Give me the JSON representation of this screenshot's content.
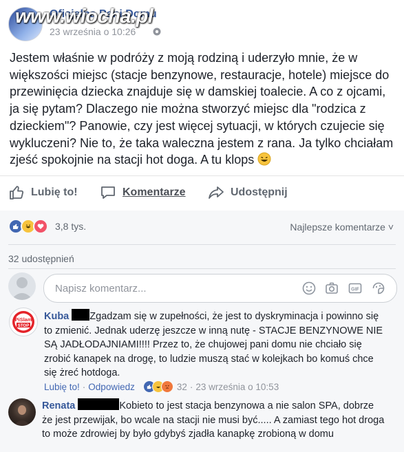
{
  "header": {
    "page_name": "Oficjalna Pani Domu",
    "date": "23 września o 10:26",
    "watermark": "www.wiocha.pl"
  },
  "post": {
    "text": "Jestem właśnie w podróży z moją rodziną i uderzyło mnie, że w większości miejsc (stacje benzynowe, restauracje, hotele) miejsce do przewinięcia dziecka znajduje się w damskiej toalecie. A co z ojcami, ja się pytam? Dlaczego nie można stworzyć miejsc dla \"rodzica z dzieckiem\"? Panowie, czy jest więcej sytuacji, w których czujecie się wykluczeni? Nie to, że taka waleczna jestem z rana. Ja tylko chciałam zjeść spokojnie na stacji hot doga. A tu klops"
  },
  "actions": {
    "like": "Lubię to!",
    "comment": "Komentarze",
    "share": "Udostępnij"
  },
  "reactions": {
    "count": "3,8 tys.",
    "sort": "Najlepsze komentarze ˅",
    "shares": "32 udostępnień"
  },
  "composer": {
    "placeholder": "Napisz komentarz..."
  },
  "comments": [
    {
      "author": "Kuba",
      "text": "Zgadzam się w zupełności, że jest to dyskryminacja i powinno się to zmienić. Jednak uderzę jeszcze w inną nutę - STACJE BENZYNOWE NIE SĄ JADŁODAJNIAMI!!!! Przez to, że chujowej pani domu nie chciało się zrobić kanapek na drogę, to ludzie muszą stać w kolejkach bo komuś chce się żreć hotdoga.",
      "avatar_text": "PiSlam STOP",
      "like": "Lubię to!",
      "sep": "·",
      "reply": "Odpowiedz",
      "reaction_count": "32",
      "date": "23 września o 10:53"
    },
    {
      "author": "Renata",
      "text": "Kobieto to jest stacja benzynowa a nie salon SPA, dobrze że jest przewijak, bo wcale na stacji nie musi być..... A zamiast tego hot droga to może zdrowiej by było gdybyś zjadła kanapkę zrobioną w domu"
    }
  ],
  "colors": {
    "link": "#365899",
    "muted": "#90949c",
    "background_comments": "#f6f7f9",
    "like_blue": "#4267b2",
    "love_red": "#f25268",
    "haha_yellow": "#f7c33d"
  },
  "icons": [
    "globe-icon",
    "thumbs-up-icon",
    "comment-icon",
    "share-icon",
    "like-reaction-icon",
    "haha-reaction-icon",
    "love-reaction-icon",
    "angry-reaction-icon",
    "smiley-icon",
    "camera-icon",
    "gif-icon",
    "sticker-icon",
    "laughing-emoji-icon"
  ]
}
